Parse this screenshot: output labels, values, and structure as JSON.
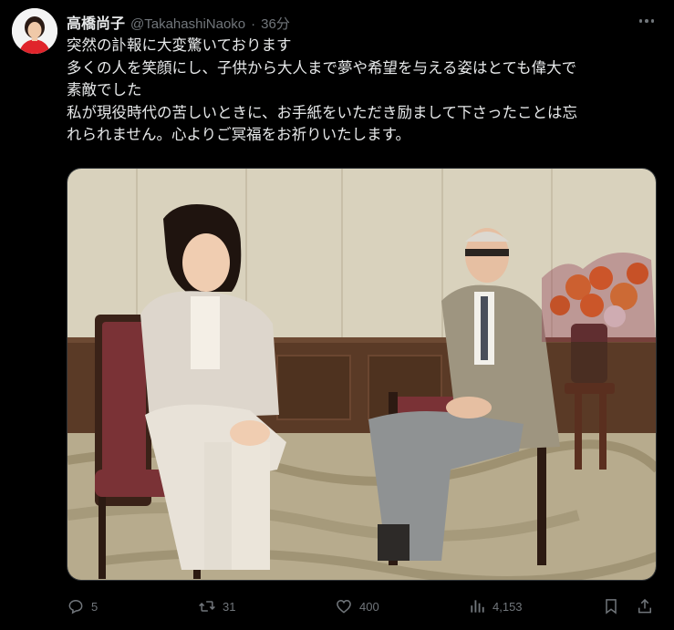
{
  "author": {
    "display_name": "高橋尚子",
    "handle": "@TakahashiNaoko",
    "separator": "·",
    "time_ago": "36分"
  },
  "tweet": {
    "lines": [
      "突然の訃報に大変驚いております",
      "多くの人を笑顔にし、子供から大人まで夢や希望を与える姿はとても偉大で",
      "素敵でした",
      "私が現役時代の苦しいときに、お手紙をいただき励まして下さったことは忘",
      "れられません。心よりご冥福をお祈りいたします。"
    ]
  },
  "actions": {
    "reply_count": "5",
    "retweet_count": "31",
    "like_count": "400",
    "view_count": "4,153"
  },
  "colors": {
    "background": "#000000",
    "text": "#e7e9ea",
    "muted": "#71767b"
  },
  "icons": [
    "more-icon",
    "reply-icon",
    "retweet-icon",
    "like-icon",
    "views-icon",
    "bookmark-icon",
    "share-icon"
  ]
}
